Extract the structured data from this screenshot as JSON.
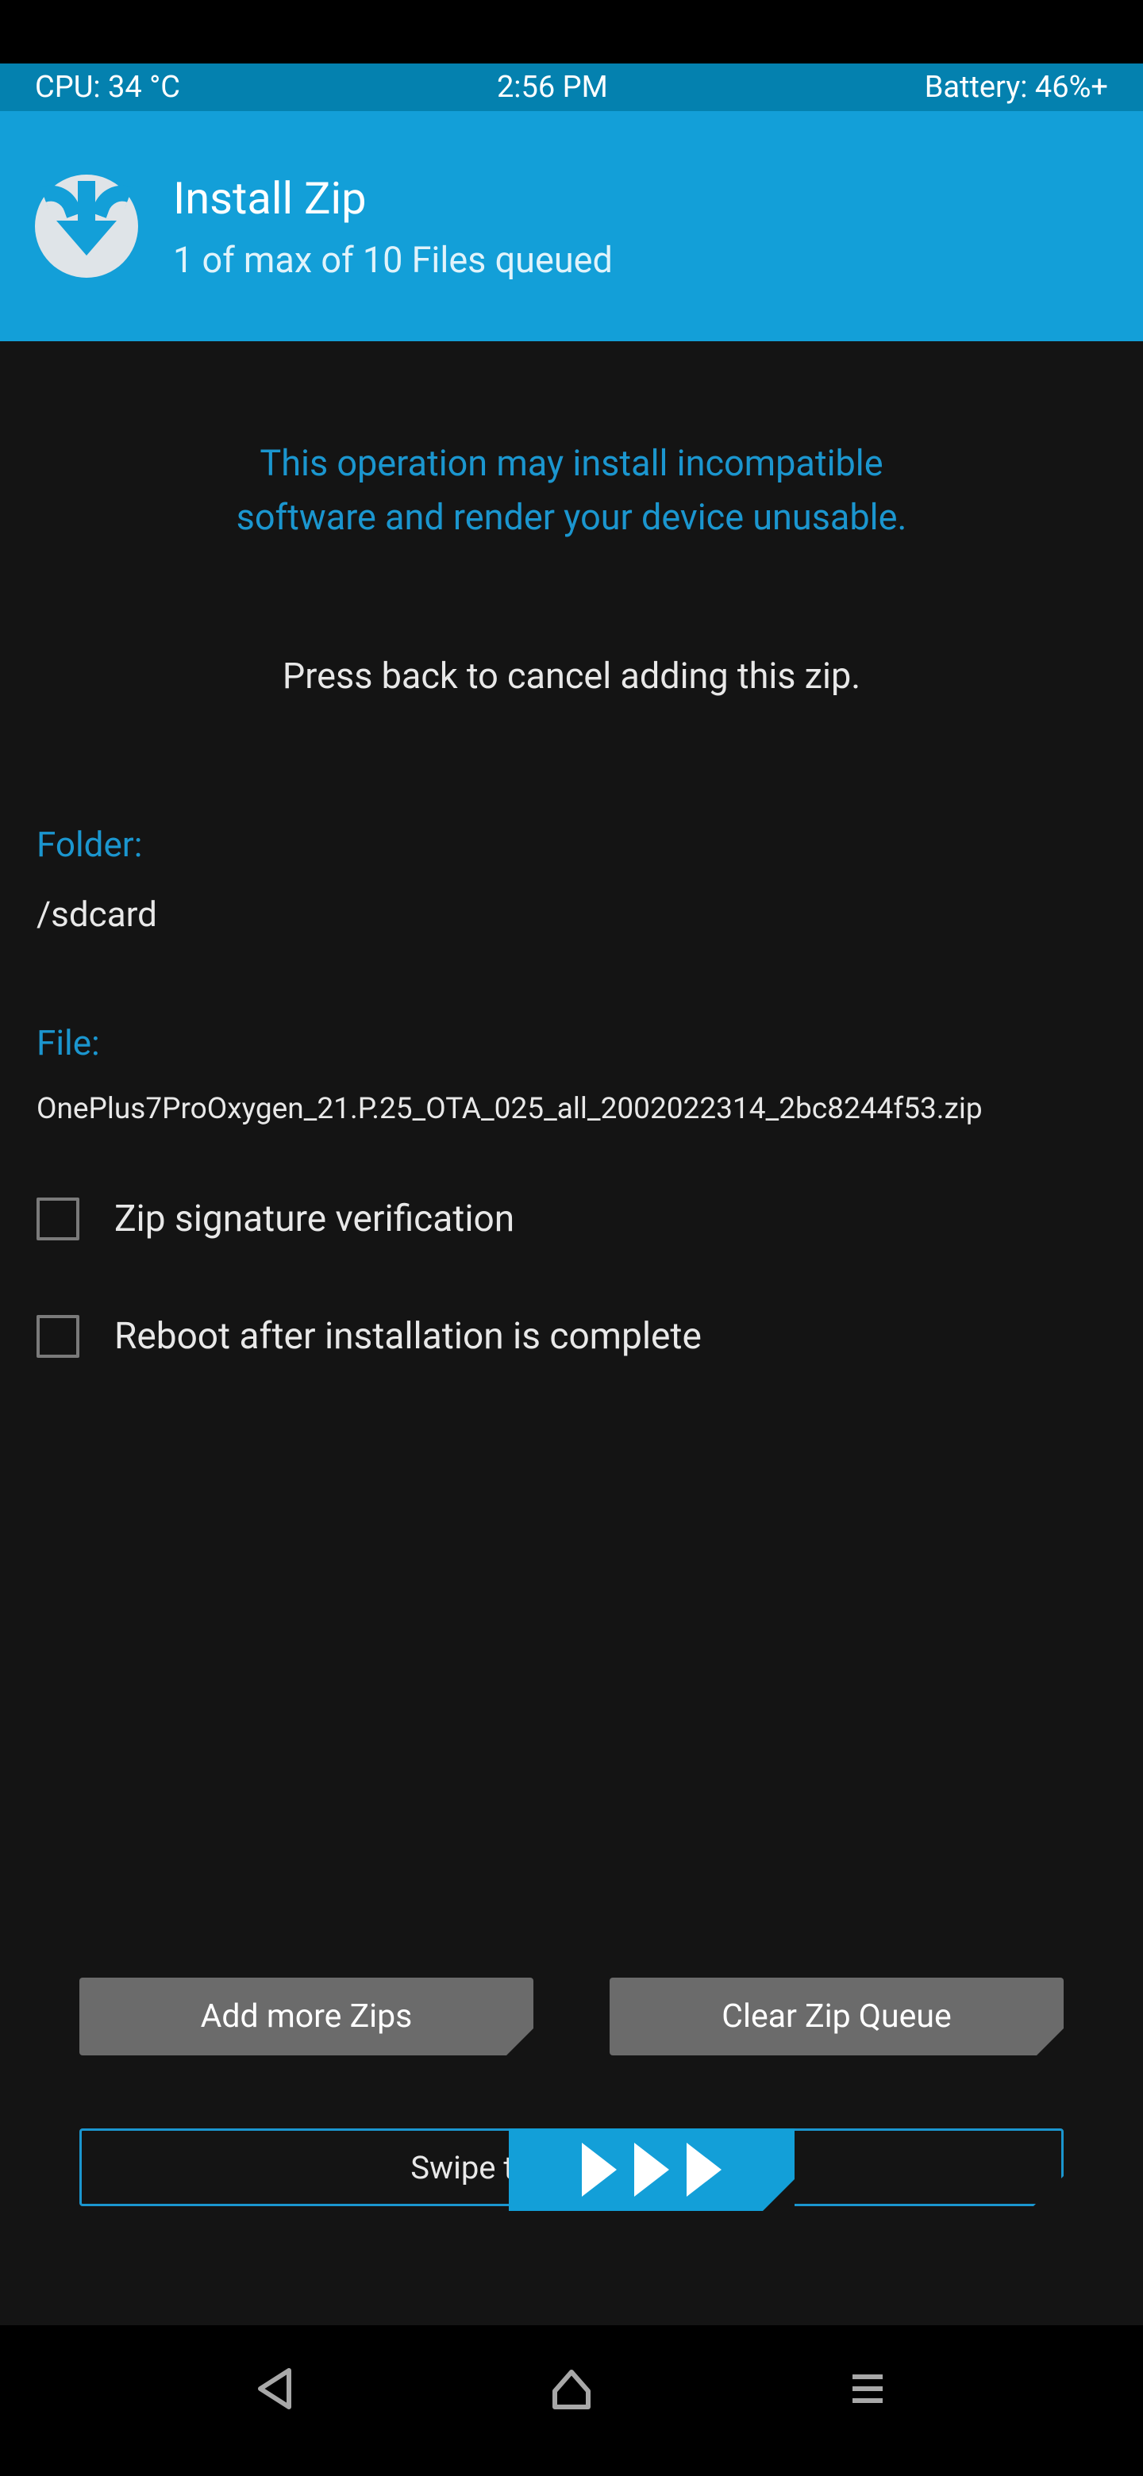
{
  "status": {
    "cpu": "CPU: 34 °C",
    "time": "2:56 PM",
    "battery": "Battery: 46%+"
  },
  "header": {
    "title": "Install Zip",
    "subtitle": "1 of max of 10 Files queued"
  },
  "warning": {
    "line1": "This operation may install incompatible",
    "line2": "software and render your device unusable."
  },
  "instruction": "Press back to cancel adding this zip.",
  "folder": {
    "label": "Folder:",
    "value": "/sdcard"
  },
  "file": {
    "label": "File:",
    "value": "OnePlus7ProOxygen_21.P.25_OTA_025_all_2002022314_2bc8244f53.zip"
  },
  "checkboxes": {
    "zip_sig": {
      "label": "Zip signature verification",
      "checked": false
    },
    "reboot": {
      "label": "Reboot after installation is complete",
      "checked": false
    }
  },
  "buttons": {
    "add_more": "Add more Zips",
    "clear_queue": "Clear Zip Queue"
  },
  "swipe": {
    "label": "Swipe to confirm Flash"
  },
  "icons": {
    "back": "back-icon",
    "home": "home-icon",
    "menu": "menu-icon",
    "twrp": "twrp-logo"
  }
}
